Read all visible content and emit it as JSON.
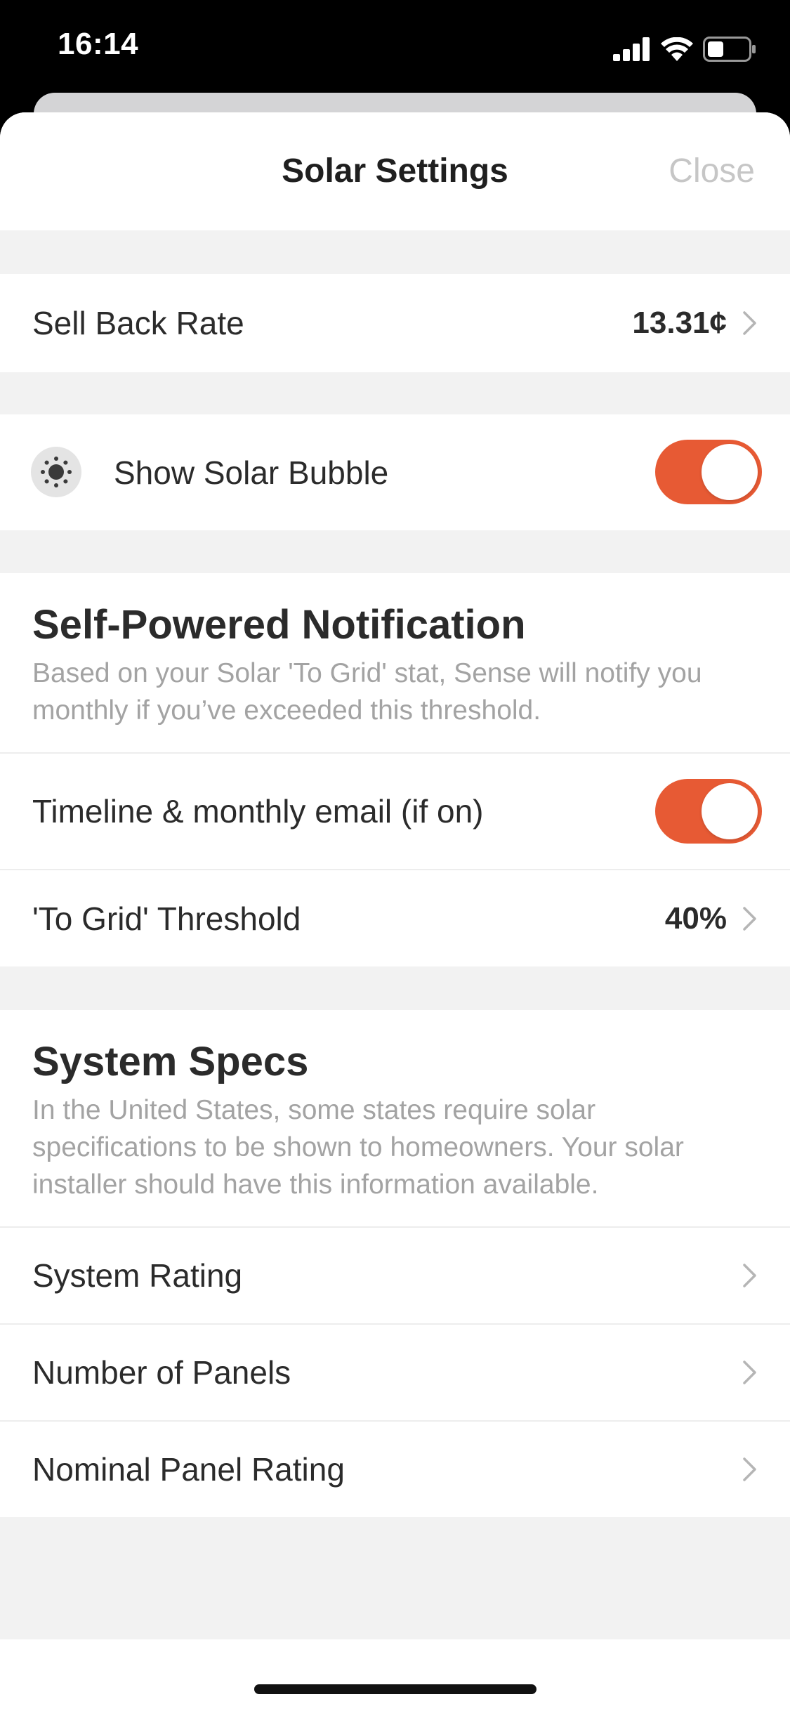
{
  "status_bar": {
    "time": "16:14",
    "icons": [
      "cellular-signal-icon",
      "wifi-icon",
      "battery-icon"
    ]
  },
  "nav": {
    "title": "Solar Settings",
    "close_label": "Close"
  },
  "sell_back": {
    "label": "Sell Back Rate",
    "value": "13.31¢"
  },
  "solar_bubble": {
    "label": "Show Solar Bubble",
    "icon": "sun-icon",
    "enabled": true
  },
  "self_powered": {
    "title": "Self-Powered Notification",
    "description": "Based on your Solar 'To Grid' stat, Sense will notify you monthly if you’ve exceeded this threshold.",
    "email_label": "Timeline & monthly email (if on)",
    "email_enabled": true,
    "threshold_label": "'To Grid' Threshold",
    "threshold_value": "40%"
  },
  "system_specs": {
    "title": "System Specs",
    "description": "In the United States, some states require solar specifications to be shown to homeowners. Your solar installer should have this information available.",
    "items": [
      {
        "label": "System Rating"
      },
      {
        "label": "Number of Panels"
      },
      {
        "label": "Nominal Panel Rating"
      }
    ]
  },
  "colors": {
    "accent": "#e75a34",
    "background": "#f2f2f2",
    "muted_text": "#a3a3a3"
  }
}
